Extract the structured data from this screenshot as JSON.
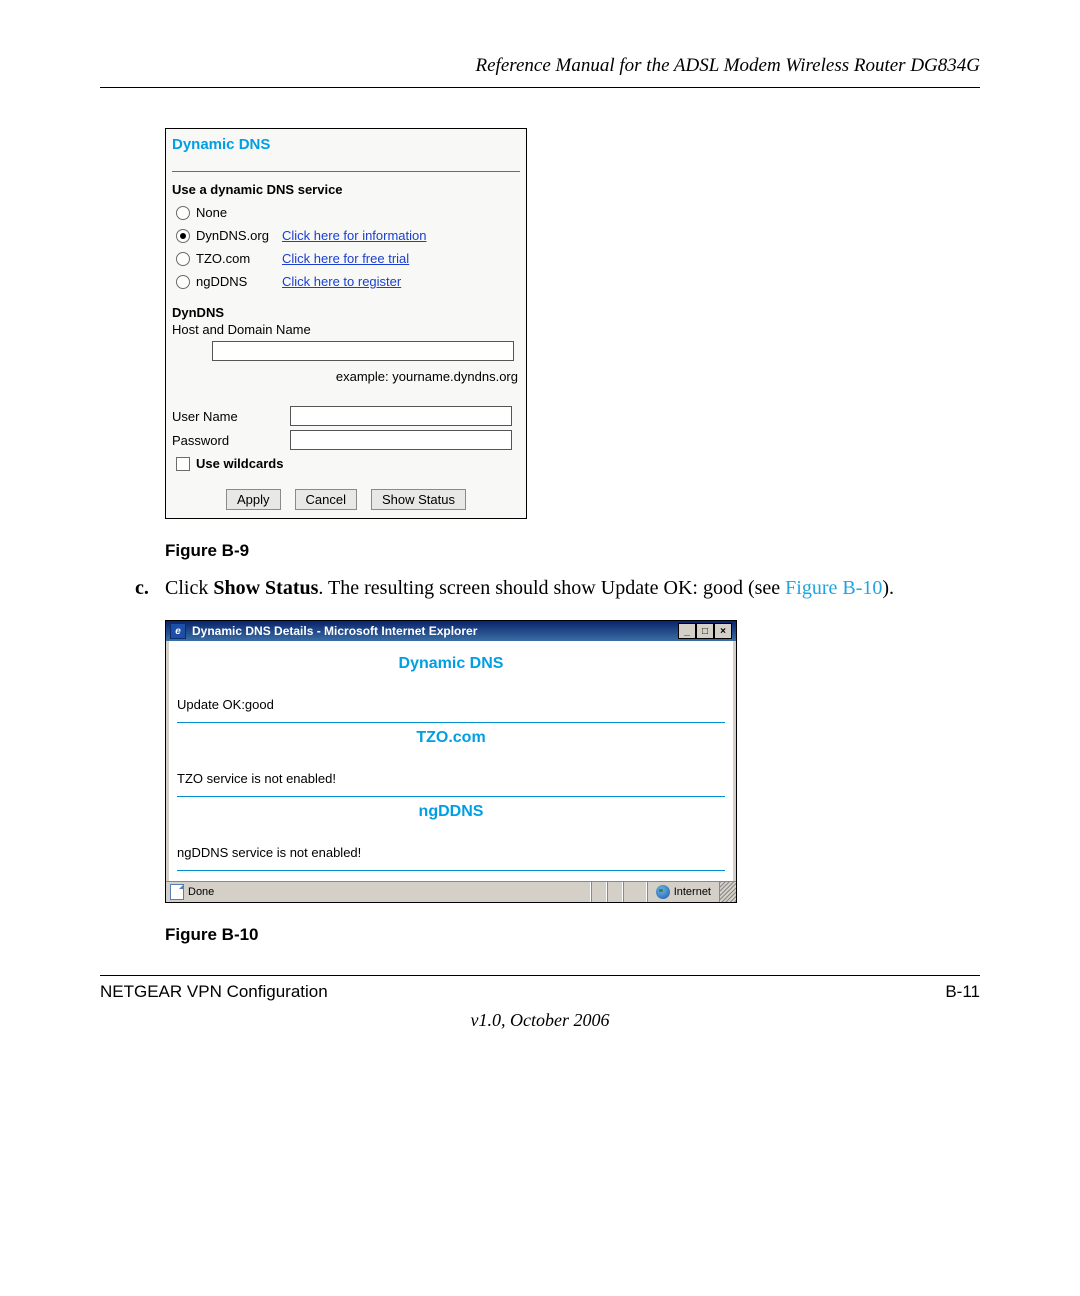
{
  "header": {
    "title": "Reference Manual for the ADSL Modem Wireless Router DG834G"
  },
  "panel1": {
    "title": "Dynamic DNS",
    "use_service_label": "Use a dynamic DNS service",
    "options": {
      "none": "None",
      "dyndns": "DynDNS.org",
      "dyndns_link": "Click here for information",
      "tzo": "TZO.com",
      "tzo_link": "Click here for free trial",
      "ngddns": "ngDDNS",
      "ngddns_link": "Click here to register"
    },
    "subhead": "DynDNS",
    "host_label": "Host and Domain Name",
    "hint": "example: yourname.dyndns.org",
    "username_label": "User Name",
    "password_label": "Password",
    "wildcards_label": "Use wildcards",
    "buttons": {
      "apply": "Apply",
      "cancel": "Cancel",
      "show_status": "Show Status"
    }
  },
  "caption1": "Figure B-9",
  "step": {
    "marker": "c.",
    "text_before": "Click ",
    "bold": "Show Status",
    "text_mid": ". The resulting screen should show Update OK: good (see ",
    "figref": "Figure B-10",
    "text_after": ")."
  },
  "panel2": {
    "window_title": "Dynamic DNS Details - Microsoft Internet Explorer",
    "h_dyndns": "Dynamic DNS",
    "update_status": "Update OK:good",
    "h_tzo": "TZO.com",
    "tzo_status": "TZO service is not enabled!",
    "h_ngddns": "ngDDNS",
    "ngddns_status": "ngDDNS service is not enabled!",
    "status_done": "Done",
    "status_zone": "Internet",
    "winbtn_min": "_",
    "winbtn_max": "□",
    "winbtn_close": "×"
  },
  "caption2": "Figure B-10",
  "footer": {
    "left": "NETGEAR VPN Configuration",
    "right": "B-11",
    "version": "v1.0, October 2006"
  }
}
